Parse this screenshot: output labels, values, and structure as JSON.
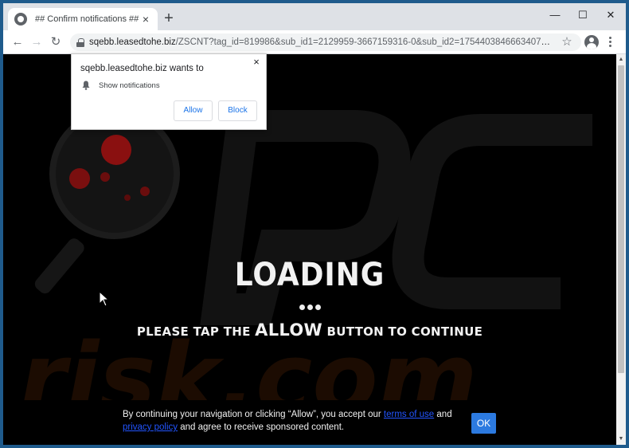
{
  "tab": {
    "title": "## Confirm notifications ##",
    "close": "×"
  },
  "new_tab": "+",
  "window_controls": {
    "minimize": "—",
    "maximize": "☐",
    "close": "✕"
  },
  "toolbar": {
    "back": "←",
    "forward": "→",
    "reload": "↻",
    "url_host": "sqebb.leasedtohe.biz",
    "url_path": "/ZSCNT?tag_id=819986&sub_id1=2129959-3667159316-0&sub_id2=1754403846663407573&cook...",
    "star": "☆"
  },
  "popup": {
    "heading": "sqebb.leasedtohe.biz wants to",
    "permission": "Show notifications",
    "allow_label": "Allow",
    "block_label": "Block",
    "close": "×"
  },
  "page": {
    "loading": "LOADING",
    "instruction_before": "PLEASE TAP THE ",
    "instruction_allow": "ALLOW",
    "instruction_after": " BUTTON TO CONTINUE"
  },
  "consent": {
    "text_1": "By continuing your navigation or clicking “Allow”, you accept our ",
    "terms_link": "terms of use",
    "text_2": " and ",
    "privacy_link": "privacy policy",
    "text_3": " and agree to receive sponsored content.",
    "ok_label": "OK"
  },
  "watermark": {
    "text": "risk.com"
  },
  "colors": {
    "accent": "#1a73e8",
    "ok_button": "#2c7ae0",
    "link": "#2255ff",
    "watermark_red": "#8a1010",
    "watermark_orange": "#5a2a00"
  }
}
